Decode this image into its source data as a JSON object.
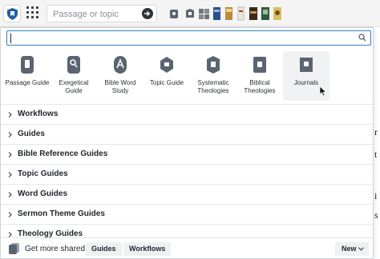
{
  "toolbar": {
    "search_placeholder": "Passage or topic",
    "resource_icons": [
      "resource-icon-1",
      "resource-icon-2",
      "resource-icon-3",
      "resource-icon-4",
      "resource-icon-5",
      "resource-icon-6",
      "resource-icon-7",
      "resource-icon-8",
      "resource-icon-9"
    ]
  },
  "panel": {
    "filter_value": "",
    "tiles": [
      {
        "label": "Passage Guide",
        "icon": "passage-guide-icon"
      },
      {
        "label": "Exegetical Guide",
        "icon": "exegetical-guide-icon"
      },
      {
        "label": "Bible Word Study",
        "icon": "bible-word-study-icon"
      },
      {
        "label": "Topic Guide",
        "icon": "topic-guide-icon"
      },
      {
        "label": "Systematic Theologies",
        "icon": "systematic-theologies-icon"
      },
      {
        "label": "Biblical Theologies",
        "icon": "biblical-theologies-icon"
      },
      {
        "label": "Journals",
        "icon": "journals-icon"
      }
    ],
    "sections": [
      {
        "label": "Workflows"
      },
      {
        "label": "Guides"
      },
      {
        "label": "Bible Reference Guides"
      },
      {
        "label": "Topic Guides"
      },
      {
        "label": "Word Guides"
      },
      {
        "label": "Sermon Theme Guides"
      },
      {
        "label": "Theology Guides"
      }
    ],
    "footer": {
      "prompt": "Get more shared:",
      "guides_label": "Guides",
      "workflows_label": "Workflows",
      "new_label": "New"
    }
  },
  "colors": {
    "accent": "#2e7fc0",
    "icon_gray": "#5b6470",
    "toolbar_bg": "#f4f4f4"
  }
}
